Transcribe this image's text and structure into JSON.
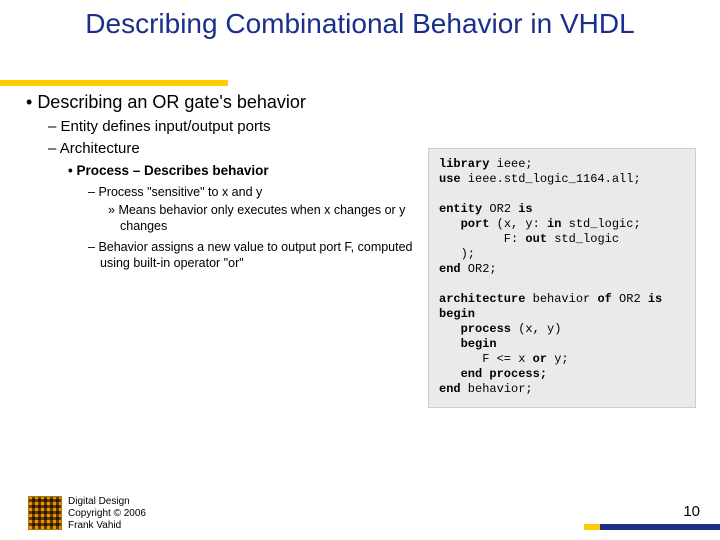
{
  "title": "Describing Combinational Behavior in VHDL",
  "bullets": {
    "b1": "Describing an OR gate's behavior",
    "b1a": "Entity defines input/output ports",
    "b1b": "Architecture",
    "b1b1": "Process – Describes behavior",
    "b1b1a": "Process \"sensitive\" to x and y",
    "b1b1a1": "Means behavior only executes when x changes or y changes",
    "b1b1b": "Behavior assigns a new value to output port F, computed using built-in operator \"or\""
  },
  "code": {
    "l1a": "library",
    "l1b": " ieee;",
    "l2a": "use",
    "l2b": " ieee.std_logic_1164.all;",
    "blank1": " ",
    "l3a": "entity",
    "l3b": " OR2 ",
    "l3c": "is",
    "l4a": "   port",
    "l4b": " (x, y: ",
    "l4c": "in",
    "l4d": " std_logic;",
    "l5a": "         F: ",
    "l5b": "out",
    "l5c": " std_logic",
    "l6": "   );",
    "l7a": "end",
    "l7b": " OR2;",
    "blank2": " ",
    "l8a": "architecture",
    "l8b": " behavior ",
    "l8c": "of",
    "l8d": " OR2 ",
    "l8e": "is",
    "l9": "begin",
    "l10a": "   process",
    "l10b": " (x, y)",
    "l11": "   begin",
    "l12a": "      F <= x ",
    "l12b": "or",
    "l12c": " y;",
    "l13": "   end process;",
    "l14a": "end",
    "l14b": " behavior;"
  },
  "footer": {
    "line1": "Digital Design",
    "line2": "Copyright © 2006",
    "line3": "Frank Vahid"
  },
  "page": "10"
}
